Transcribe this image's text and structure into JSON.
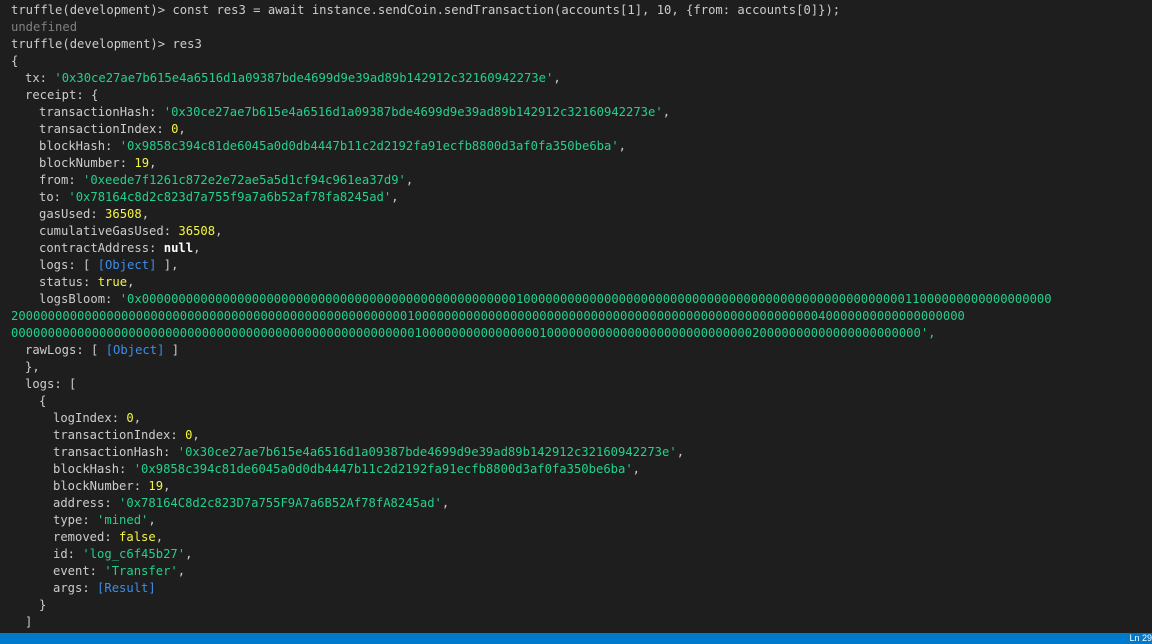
{
  "terminal": {
    "prompt": "truffle(development)> ",
    "command1": "const res3 = await instance.sendCoin.sendTransaction(accounts[1], 10, {from: accounts[0]});",
    "undefined_text": "undefined",
    "command2": "res3",
    "tx_hash": "'0x30ce27ae7b615e4a6516d1a09387bde4699d9e39ad89b142912c32160942273e'",
    "receipt": {
      "transactionHash": "'0x30ce27ae7b615e4a6516d1a09387bde4699d9e39ad89b142912c32160942273e'",
      "transactionIndex": "0",
      "blockHash": "'0x9858c394c81de6045a0d0db4447b11c2d2192fa91ecfb8800d3af0fa350be6ba'",
      "blockNumber": "19",
      "from": "'0xeede7f1261c872e2e72ae5a5d1cf94c961ea37d9'",
      "to": "'0x78164c8d2c823d7a755f9a7a6b52af78fa8245ad'",
      "gasUsed": "36508",
      "cumulativeGasUsed": "36508",
      "contractAddress": "null",
      "logs_object": "[Object]",
      "status": "true",
      "logsBloom_line1": "'0x0000000000000000000000000000000000000000000000000001000000000000000000000000000000000000000000000000000011000000000000000000",
      "logsBloom_line2": "2000000000000000000000000000000000000000000000000000001000000000000000000000000000000000000000000000000000000040000000000000000000",
      "logsBloom_line3": "0000000000000000000000000000000000000000000000000000000100000000000000001000000000000000000000000000020000000000000000000000',",
      "rawLogs_object": "[Object]"
    },
    "log": {
      "logIndex": "0",
      "transactionIndex": "0",
      "transactionHash": "'0x30ce27ae7b615e4a6516d1a09387bde4699d9e39ad89b142912c32160942273e'",
      "blockHash": "'0x9858c394c81de6045a0d0db4447b11c2d2192fa91ecfb8800d3af0fa350be6ba'",
      "blockNumber": "19",
      "address": "'0x78164C8d2c823D7a755F9A7a6B52Af78fA8245ad'",
      "type": "'mined'",
      "removed": "false",
      "id": "'log_c6f45b27'",
      "event": "'Transfer'",
      "args": "[Result]"
    }
  },
  "statusbar": {
    "position": "Ln 29"
  },
  "colors": {
    "background": "#1e1e1e",
    "foreground": "#cccccc",
    "string": "#23d18b",
    "number": "#f5f543",
    "object_ref": "#3b8eea",
    "keyword": "#ffffff",
    "muted": "#808080",
    "statusbar": "#007acc"
  }
}
